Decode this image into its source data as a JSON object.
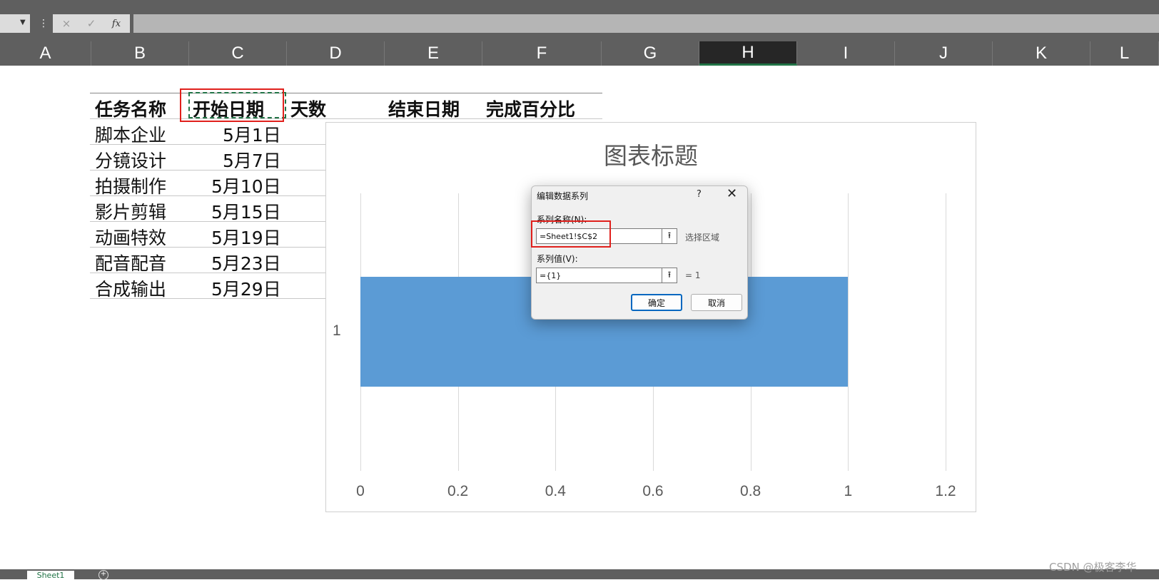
{
  "formula_bar": {
    "fx_label": "fx",
    "cancel_icon": "×",
    "enter_icon": "✓",
    "formula": ""
  },
  "columns": [
    "A",
    "B",
    "C",
    "D",
    "E",
    "F",
    "G",
    "H",
    "I",
    "J",
    "K",
    "L"
  ],
  "selected_column": "H",
  "sheet": {
    "headers": {
      "task": "任务名称",
      "start": "开始日期",
      "days": "天数",
      "end": "结束日期",
      "pct": "完成百分比"
    },
    "rows": [
      {
        "task": "脚本企业",
        "start": "5月1日"
      },
      {
        "task": "分镜设计",
        "start": "5月7日"
      },
      {
        "task": "拍摄制作",
        "start": "5月10日"
      },
      {
        "task": "影片剪辑",
        "start": "5月15日"
      },
      {
        "task": "动画特效",
        "start": "5月19日"
      },
      {
        "task": "配音配音",
        "start": "5月23日"
      },
      {
        "task": "合成输出",
        "start": "5月29日"
      }
    ]
  },
  "chart_data": {
    "type": "bar",
    "orientation": "horizontal",
    "title": "图表标题",
    "categories": [
      "1"
    ],
    "values": [
      1
    ],
    "xlim": [
      0,
      1.2
    ],
    "xticks": [
      "0",
      "0.2",
      "0.4",
      "0.6",
      "0.8",
      "1",
      "1.2"
    ],
    "grid": true,
    "bar_color": "#5b9bd5"
  },
  "dialog": {
    "title": "编辑数据系列",
    "help": "?",
    "close": "✕",
    "name_label": "系列名称(N):",
    "name_value": "=Sheet1!$C$2",
    "name_aside": "选择区域",
    "values_label": "系列值(V):",
    "values_value": "={1}",
    "values_aside": "= 1",
    "ok": "确定",
    "cancel": "取消"
  },
  "sheet_tab": "Sheet1",
  "add_sheet": "+",
  "watermark": "CSDN @极客李华",
  "colors": {
    "accent": "#217346",
    "highlight": "#e0201c",
    "bar": "#5b9bd5"
  }
}
